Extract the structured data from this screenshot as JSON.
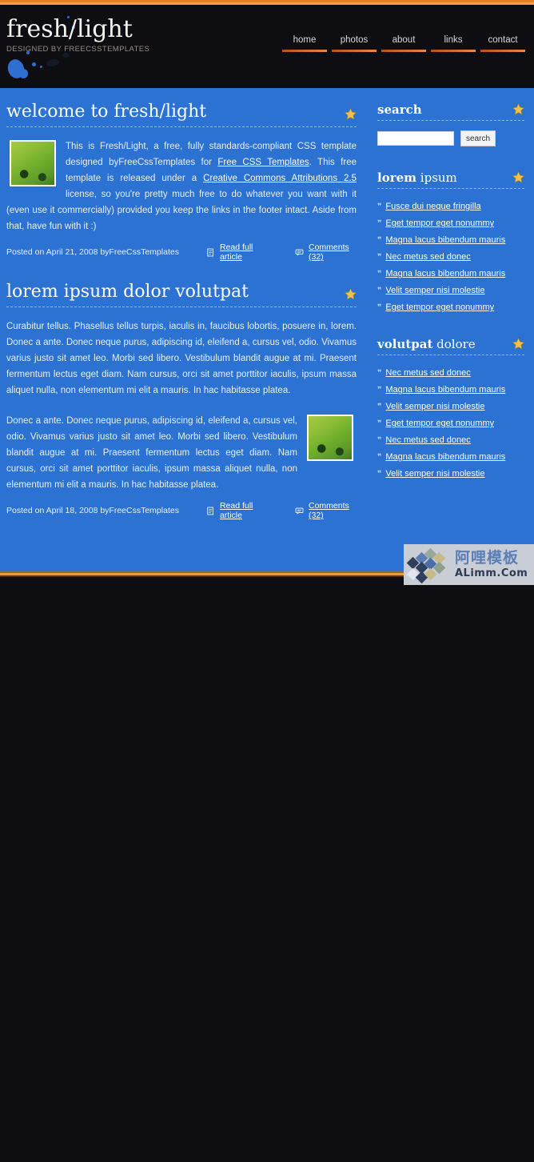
{
  "site": {
    "logo_title": "fresh/light",
    "logo_tagline": "DESIGNED BY FREECSSTEMPLATES"
  },
  "nav": {
    "items": [
      {
        "label": "home"
      },
      {
        "label": "photos"
      },
      {
        "label": "about"
      },
      {
        "label": "links"
      },
      {
        "label": "contact"
      }
    ]
  },
  "posts": [
    {
      "title": "welcome to fresh/light",
      "body_parts": {
        "p1": "This is Fresh/Light, a free, fully standards-compliant CSS template designed byFreeCssTemplates for ",
        "link1": "Free CSS Templates",
        "p2": ". This free template is released under a ",
        "link2": "Creative Commons Attributions 2.5",
        "p3": " license, so you're pretty much free to do whatever you want with it (even use it commercially) provided you keep the links in the footer intact. Aside from that, have fun with it :)"
      },
      "posted": "Posted on April 21, 2008 byFreeCssTemplates",
      "read_more": "Read full article",
      "comments": "Comments (32)"
    },
    {
      "title": "lorem ipsum dolor volutpat",
      "para1": "Curabitur tellus. Phasellus tellus turpis, iaculis in, faucibus lobortis, posuere in, lorem. Donec a ante. Donec neque purus, adipiscing id, eleifend a, cursus vel, odio. Vivamus varius justo sit amet leo. Morbi sed libero. Vestibulum blandit augue at mi. Praesent fermentum lectus eget diam. Nam cursus, orci sit amet porttitor iaculis, ipsum massa aliquet nulla, non elementum mi elit a mauris. In hac habitasse platea.",
      "para2": "Donec a ante. Donec neque purus, adipiscing id, eleifend a, cursus vel, odio. Vivamus varius justo sit amet leo. Morbi sed libero. Vestibulum blandit augue at mi. Praesent fermentum lectus eget diam. Nam cursus, orci sit amet porttitor iaculis, ipsum massa aliquet nulla, non elementum mi elit a mauris. In hac habitasse platea.",
      "posted": "Posted on April 18, 2008 byFreeCssTemplates",
      "read_more": "Read full article",
      "comments": "Comments (32)"
    }
  ],
  "sidebar": {
    "search": {
      "title": "search",
      "title_bold": "search",
      "title_rest": "",
      "input_value": "",
      "placeholder": "",
      "button_label": "search"
    },
    "sections": [
      {
        "title_bold": "lorem",
        "title_rest": " ipsum",
        "links": [
          "Fusce dui neque fringilla",
          "Eget tempor eget nonummy",
          "Magna lacus bibendum mauris",
          "Nec metus sed donec",
          "Magna lacus bibendum mauris",
          "Velit semper nisi molestie",
          "Eget tempor eget nonummy"
        ]
      },
      {
        "title_bold": "volutpat",
        "title_rest": " dolore",
        "links": [
          "Nec metus sed donec",
          "Magna lacus bibendum mauris",
          "Velit semper nisi molestie",
          "Eget tempor eget nonummy",
          "Nec metus sed donec",
          "Magna lacus bibendum mauris",
          "Velit semper nisi molestie"
        ]
      }
    ]
  },
  "watermark": {
    "cn": "阿哩模板",
    "en": "ALimm.Com"
  },
  "colors": {
    "accent_orange": "#e5801f",
    "page_blue": "#2b72d2",
    "header_dark": "#0d0d12",
    "star_gold": "#f2c14b",
    "link_white": "#ffffff"
  }
}
